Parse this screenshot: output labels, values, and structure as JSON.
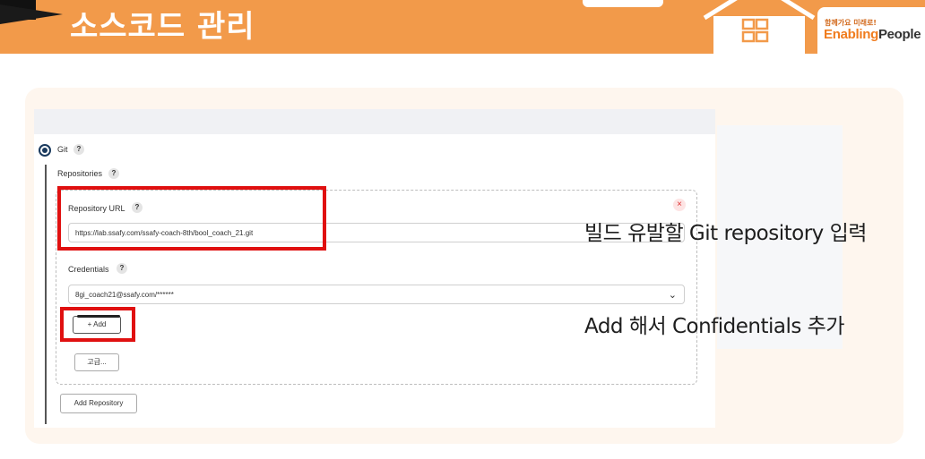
{
  "header": {
    "title": "소스코드 관리",
    "logo_tagline": "함께가요 미래로!",
    "logo_brand_a": "Enabling",
    "logo_brand_b": "People"
  },
  "colors": {
    "banner": "#f29a4a",
    "highlight": "#e01010",
    "radio": "#1a3a5e"
  },
  "scm": {
    "option_label": "Git",
    "repositories_label": "Repositories",
    "repo_url_label": "Repository URL",
    "repo_url_value": "https://lab.ssafy.com/ssafy-coach-8th/bool_coach_21.git",
    "credentials_label": "Credentials",
    "credentials_value": "8gi_coach21@ssafy.com/******",
    "add_button": "+ Add",
    "advanced_button": "고급...",
    "add_repository_button": "Add Repository",
    "help_glyph": "?",
    "remove_glyph": "×",
    "dropdown_glyph": "⌄"
  },
  "annotations": {
    "repo_note": "빌드 유발할 Git repository 입력",
    "credential_note": "Add 해서 Confidentials 추가"
  }
}
